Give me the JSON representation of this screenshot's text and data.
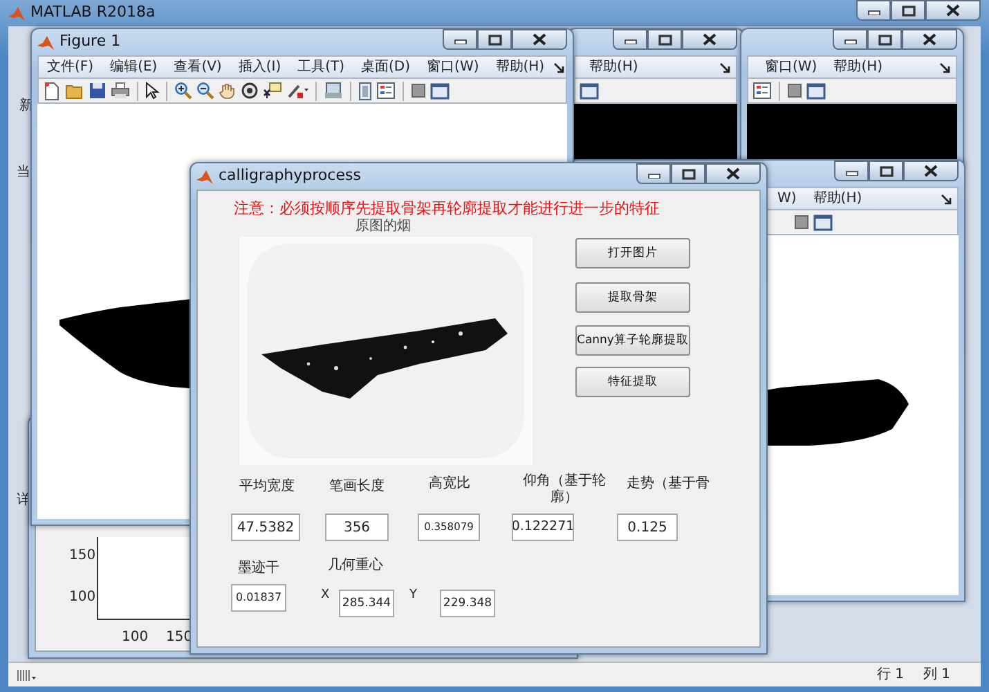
{
  "main_window": {
    "title": "MATLAB R2018a",
    "side_fragments": [
      "新",
      "当",
      "详"
    ],
    "status_bar": {
      "row": "行 1",
      "column": "列 1"
    }
  },
  "background_figure": {
    "y_ticks": [
      "150",
      "100"
    ],
    "x_ticks": [
      "100",
      "150"
    ]
  },
  "figure_windows": [
    {
      "menu": [
        "帮助(H)"
      ]
    },
    {
      "menu": [
        "窗口(W)",
        "帮助(H)"
      ]
    },
    {
      "menu": [
        "W)",
        "帮助(H)"
      ]
    },
    {
      "title": "Figure 1",
      "menu": [
        "文件(F)",
        "编辑(E)",
        "查看(V)",
        "插入(I)",
        "工具(T)",
        "桌面(D)",
        "窗口(W)",
        "帮助(H)"
      ]
    }
  ],
  "dialog": {
    "title": "calligraphyprocess",
    "notice": "注意：必须按顺序先提取骨架再轮廓提取才能进行进一步的特征",
    "image_title": "原图的烟",
    "buttons": [
      "打开图片",
      "提取骨架",
      "Canny算子轮廓提取",
      "特征提取"
    ],
    "measures": [
      {
        "label": "平均宽度",
        "value": "47.5382"
      },
      {
        "label": "笔画长度",
        "value": "356"
      },
      {
        "label": "高宽比",
        "value": "0.358079"
      },
      {
        "label": "仰角（基于轮廓）",
        "value": "0.122271"
      },
      {
        "label": "走势（基于骨",
        "value": "0.125"
      }
    ],
    "ink": {
      "label": "墨迹干",
      "value": "0.01837"
    },
    "centroid": {
      "label": "几何重心",
      "coords": [
        {
          "axis": "X",
          "value": "285.344"
        },
        {
          "axis": "Y",
          "value": "229.348"
        }
      ]
    }
  }
}
